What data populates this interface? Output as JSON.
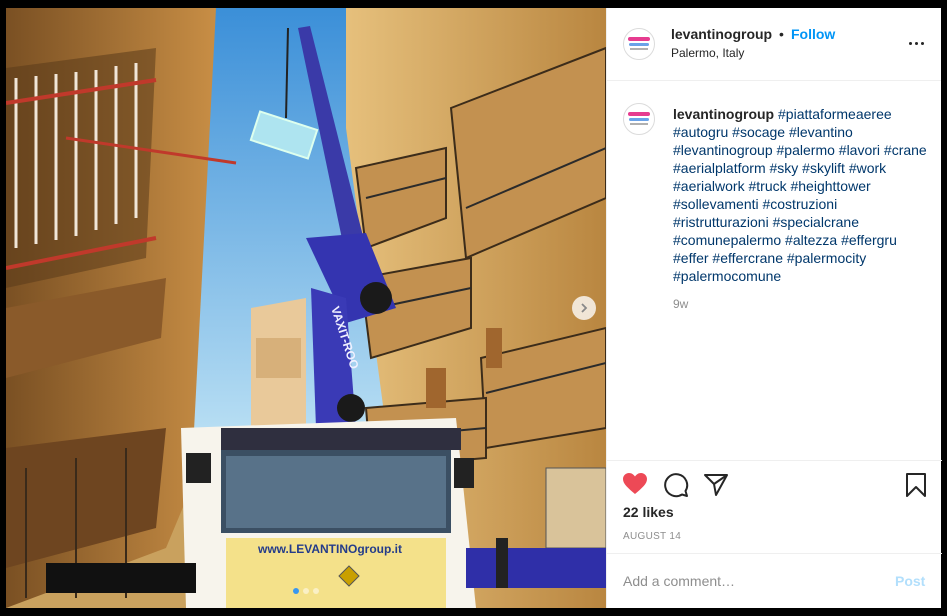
{
  "colors": {
    "accent": "#0095f6",
    "like": "#ed4956",
    "hashtag": "#00376b"
  },
  "header": {
    "username": "levantinogroup",
    "separator": "•",
    "follow_label": "Follow",
    "location": "Palermo, Italy"
  },
  "photo": {
    "truck_brand_text": "www.LEVANTINOgroup.it",
    "boom_text": "VAXIT-ROO"
  },
  "caption": {
    "username": "levantinogroup",
    "hashtags": "#piattaformeaeree #autogru #socage #levantino #levantinogroup #palermo #lavori #crane #aerialplatform #sky #skylift #work #aerialwork #truck #heighttower #sollevamenti #costruzioni #ristrutturazioni #specialcrane #comunepalermo #altezza #effergru #effer #effercrane #palermocity #palermocomune",
    "time": "9w"
  },
  "actions": {
    "like_icon": "heart-filled-icon",
    "comment_icon": "comment-icon",
    "share_icon": "send-icon",
    "save_icon": "bookmark-icon"
  },
  "likes": "22 likes",
  "date": "AUGUST 14",
  "comment": {
    "placeholder": "Add a comment…",
    "post_label": "Post"
  },
  "carousel": {
    "count": 3,
    "active": 1
  }
}
